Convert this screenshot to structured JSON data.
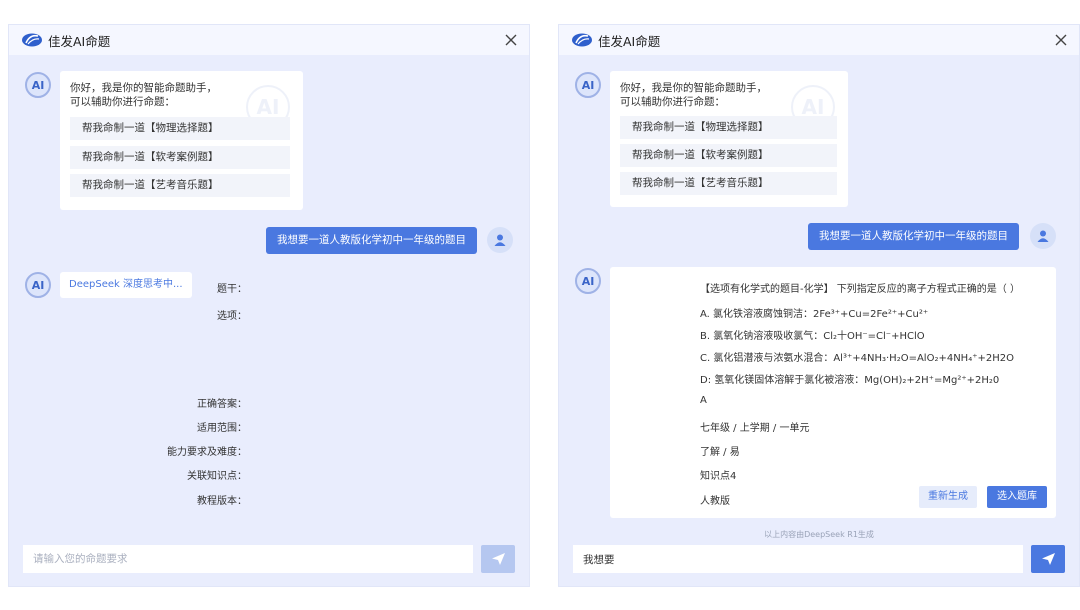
{
  "app": {
    "title": "佳发AI命题"
  },
  "ai_avatar_label": "AI",
  "greeting": {
    "line1": "你好，我是你的智能命题助手，",
    "line2": "可以辅助你进行命题：",
    "suggestions": [
      "帮我命制一道【物理选择题】",
      "帮我命制一道【软考案例题】",
      "帮我命制一道【艺考音乐题】"
    ]
  },
  "user_message": "我想要一道人教版化学初中一年级的题目",
  "left": {
    "thinking": "DeepSeek 深度思考中...",
    "input_placeholder": "请输入您的命题要求",
    "input_value": ""
  },
  "right": {
    "question": {
      "stem_label": "题干：",
      "stem": "【选项有化学式的题目-化学】 下列指定反应的离子方程式正确的是（     ）",
      "options_label": "选项：",
      "options": [
        "A.  氯化铁溶液腐蚀铜洁：2Fe³⁺+Cu=2Fe²⁺+Cu²⁺",
        "B.  氯氧化钠溶液吸收氯气：Cl₂十OH⁻=Cl⁻+HClO",
        "C.  氯化铝潜液与浓氨水混合：Al³⁺+4NH₃·H₂O=AlO₂+4NH₄⁺+2H2O",
        "D:  氢氧化镁固体溶解于氯化被溶液：Mg(OH)₂+2H⁺=Mg²⁺+2H₂0"
      ],
      "answer_label": "正确答案：",
      "answer": "A",
      "scope_label": "适用范围：",
      "scope": "七年级 / 上学期 / 一单元",
      "level_label": "能力要求及难度：",
      "level": "了解 / 易",
      "knowledge_label": "关联知识点：",
      "knowledge": "知识点4",
      "edition_label": "教程版本：",
      "edition": "人教版"
    },
    "regen_label": "重新生成",
    "add_label": "选入题库",
    "footnote": "以上内容由DeepSeek R1生成",
    "input_value": "我想要"
  },
  "colors": {
    "accent": "#4a78e0",
    "panel_bg": "#e9edfd"
  },
  "icons": {
    "logo": "jiafa-logo-icon",
    "close": "close-icon",
    "user": "user-avatar-icon",
    "send": "send-icon"
  }
}
